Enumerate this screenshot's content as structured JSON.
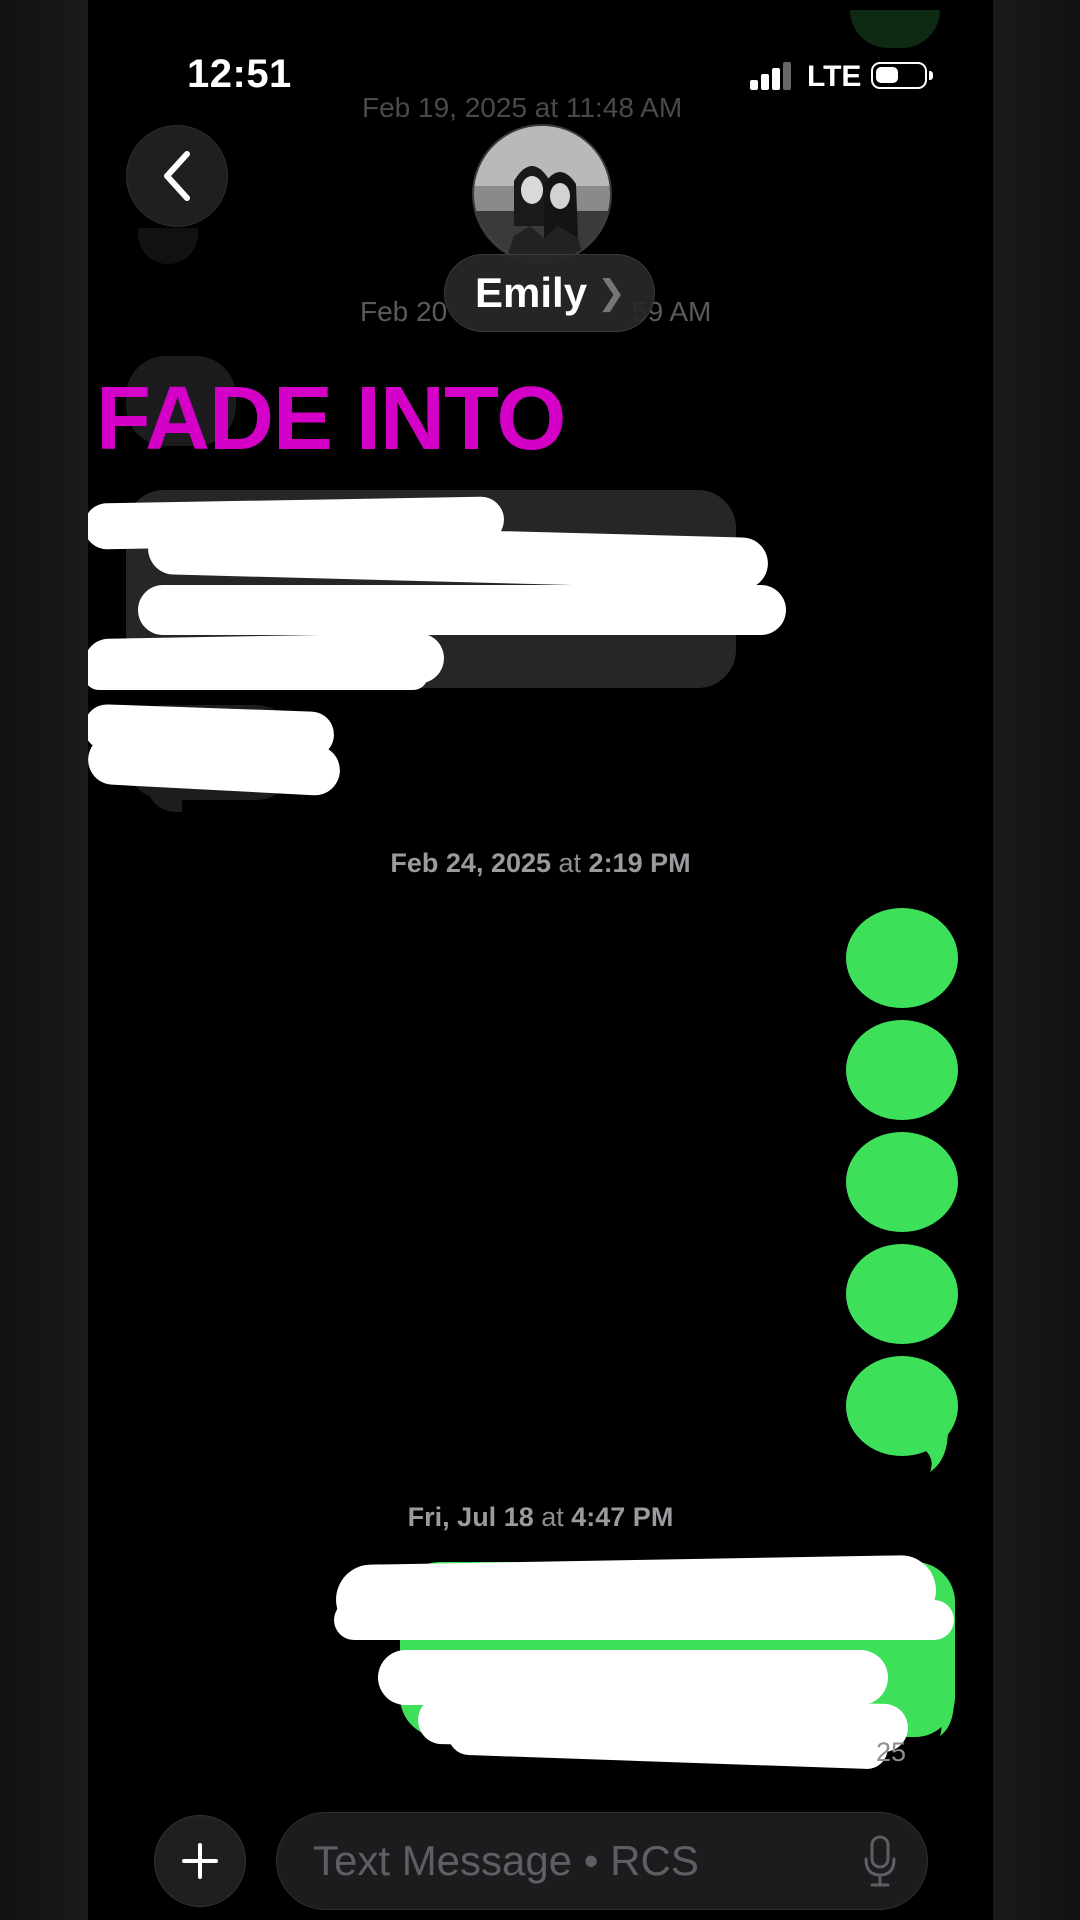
{
  "status_bar": {
    "time": "12:51",
    "network": "LTE"
  },
  "header": {
    "back_icon": "chevron-left-icon",
    "contact_name": "Emily",
    "name_chevron": "❯"
  },
  "background_timestamps": {
    "ts1": "Feb 19, 2025 at 11:48 AM",
    "ts2_left": "Feb 20",
    "ts2_right": "59 AM"
  },
  "overlay_text": {
    "title": "FADE INTO"
  },
  "timestamps": {
    "ts3_date": "Feb 24, 2025",
    "ts3_at": " at ",
    "ts3_time": "2:19 PM",
    "ts4_date": "Fri, Jul 18",
    "ts4_at": " at ",
    "ts4_time": "4:47 PM"
  },
  "read_receipt_fragment": "25",
  "composer": {
    "add_icon": "plus-icon",
    "placeholder": "Text Message • RCS",
    "mic_icon": "microphone-icon"
  },
  "colors": {
    "imessage_green": "#3ee05a",
    "overlay_magenta": "#d400c8",
    "incoming_bubble": "#262628"
  }
}
